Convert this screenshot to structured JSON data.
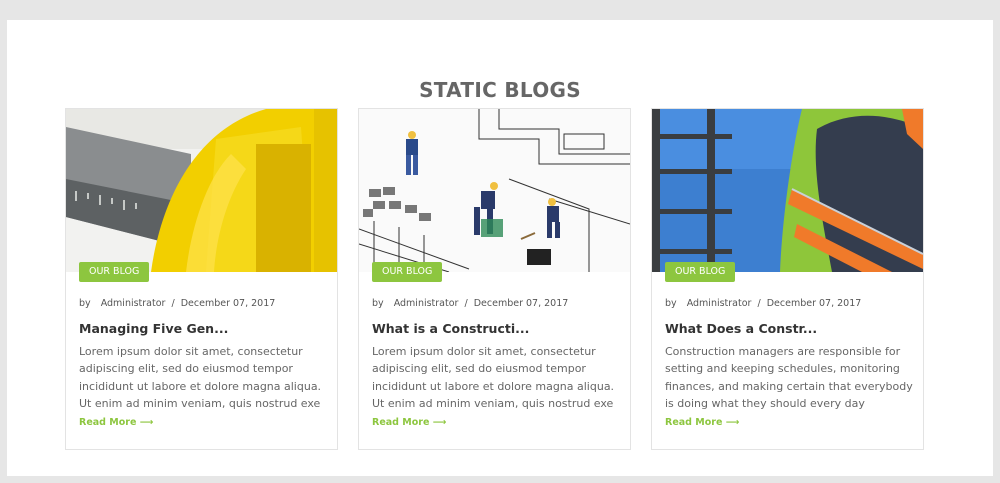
{
  "section": {
    "title": "STATIC BLOGS"
  },
  "colors": {
    "accent": "#8dc63f",
    "title": "#666666",
    "background": "#e6e6e6"
  },
  "cards": [
    {
      "badge": "OUR BLOG",
      "by": "by",
      "author": "Administrator",
      "separator": "/",
      "date": "December 07, 2017",
      "title": "Managing Five Gen...",
      "body": "Lorem ipsum dolor sit amet, consectetur adipiscing elit, sed do eiusmod tempor incididunt ut labore et dolore magna aliqua. Ut enim ad minim veniam, quis nostrud exe",
      "read_more": "Read More ⟶",
      "image": "yellow-hard-hat-and-tape-measure"
    },
    {
      "badge": "OUR BLOG",
      "by": "by",
      "author": "Administrator",
      "separator": "/",
      "date": "December 07, 2017",
      "title": "What is a Constructi...",
      "body": "Lorem ipsum dolor sit amet, consectetur adipiscing elit, sed do eiusmod tempor incididunt ut labore et dolore magna aliqua. Ut enim ad minim veniam, quis nostrud exe",
      "read_more": "Read More ⟶",
      "image": "miniature-workers-on-blueprint"
    },
    {
      "badge": "OUR BLOG",
      "by": "by",
      "author": "Administrator",
      "separator": "/",
      "date": "December 07, 2017",
      "title": "What Does a Constr...",
      "body": "Construction managers are responsible for setting and keeping schedules, monitoring finances, and making certain that everybody is doing what they should every day",
      "read_more": "Read More ⟶",
      "image": "worker-in-safety-vest-scaffolding"
    }
  ]
}
